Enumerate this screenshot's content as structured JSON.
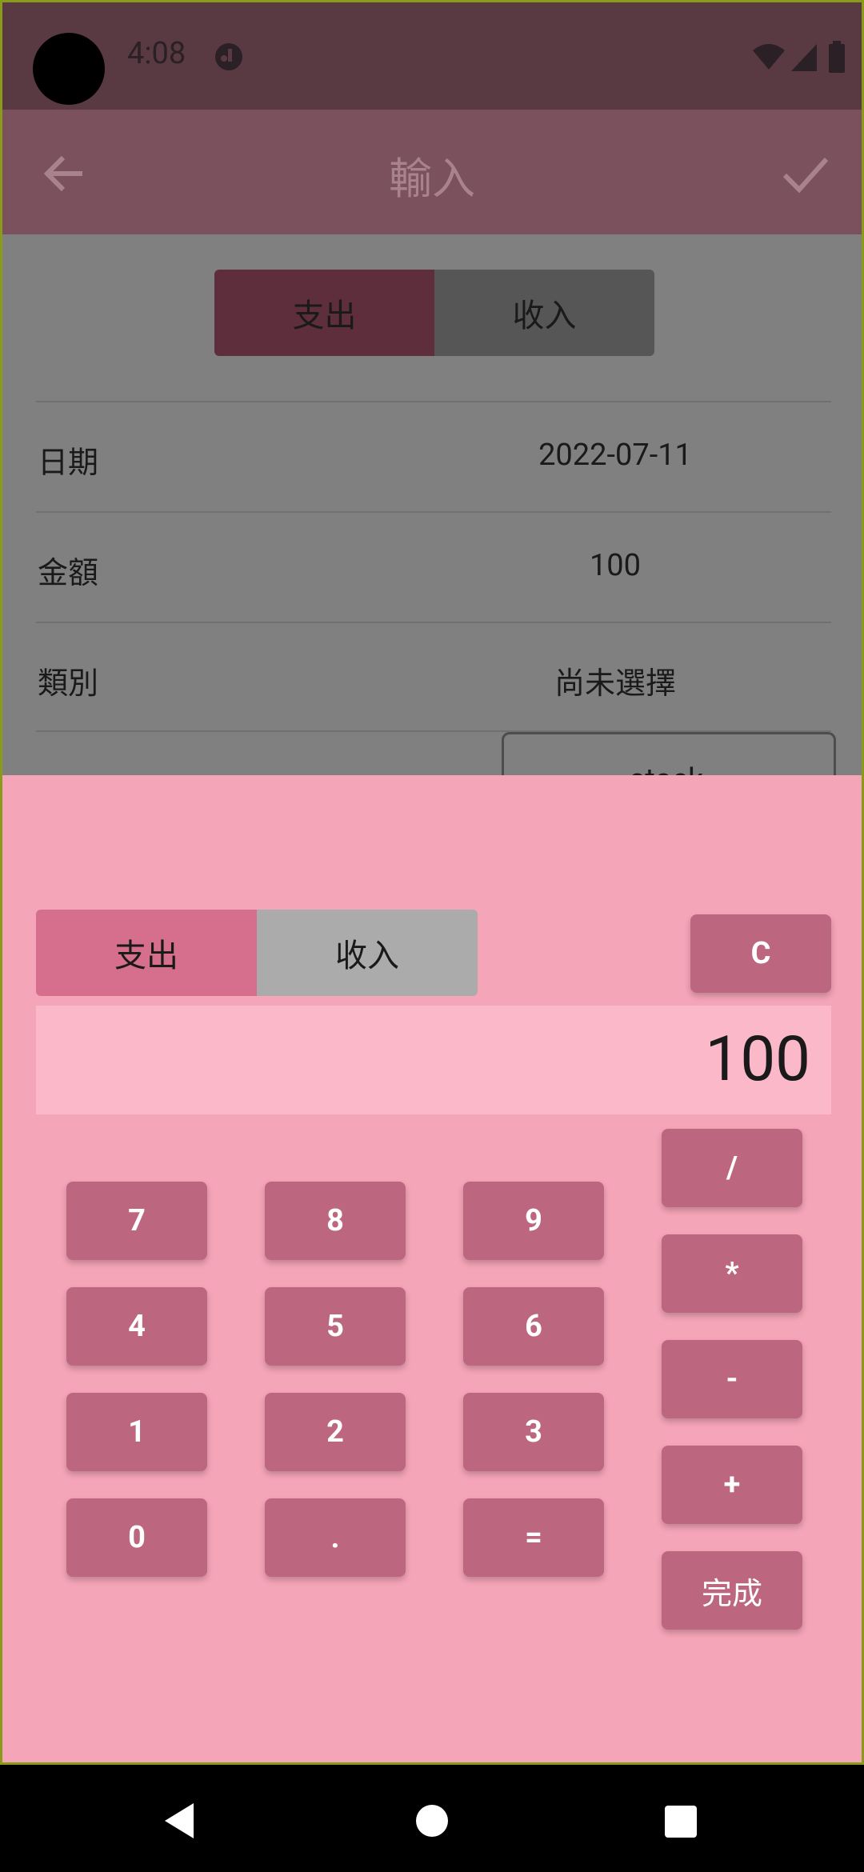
{
  "status_bar": {
    "time": "4:08"
  },
  "app_bar": {
    "title": "輸入"
  },
  "type_toggle": {
    "expense": "支出",
    "income": "收入"
  },
  "form": {
    "date_label": "日期",
    "date_value": "2022-07-11",
    "amount_label": "金額",
    "amount_value": "100",
    "category_label": "類別",
    "category_value": "尚未選擇",
    "account_value": "stock"
  },
  "calculator": {
    "type_toggle": {
      "expense": "支出",
      "income": "收入"
    },
    "clear_label": "C",
    "display": "100",
    "keys": {
      "k7": "7",
      "k8": "8",
      "k9": "9",
      "k4": "4",
      "k5": "5",
      "k6": "6",
      "k1": "1",
      "k2": "2",
      "k3": "3",
      "k0": "0",
      "dot": ".",
      "equals": "=",
      "divide": "/",
      "multiply": "*",
      "minus": "-",
      "plus": "+",
      "done": "完成"
    }
  },
  "colors": {
    "accent": "#bd6680",
    "sheet": "#f5a5b8",
    "appbar": "#7a515c"
  }
}
